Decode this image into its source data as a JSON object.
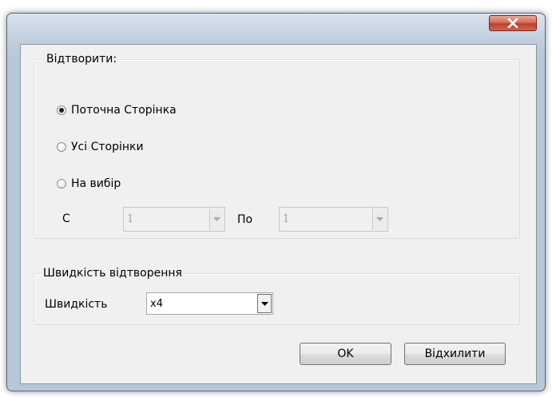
{
  "window": {
    "close_icon": "close-x-icon"
  },
  "playback_group": {
    "legend": "Відтворити:",
    "options": [
      {
        "label": "Поточна Сторінка",
        "checked": true
      },
      {
        "label": "Усі Сторінки",
        "checked": false
      },
      {
        "label": "На вибір",
        "checked": false
      }
    ],
    "from_label": "С",
    "from_value": "1",
    "to_label": "По",
    "to_value": "1"
  },
  "speed_group": {
    "legend": "Швидкість відтворення",
    "speed_label": "Швидкість",
    "speed_value": "x4"
  },
  "buttons": {
    "ok": "OK",
    "cancel": "Відхилити"
  }
}
